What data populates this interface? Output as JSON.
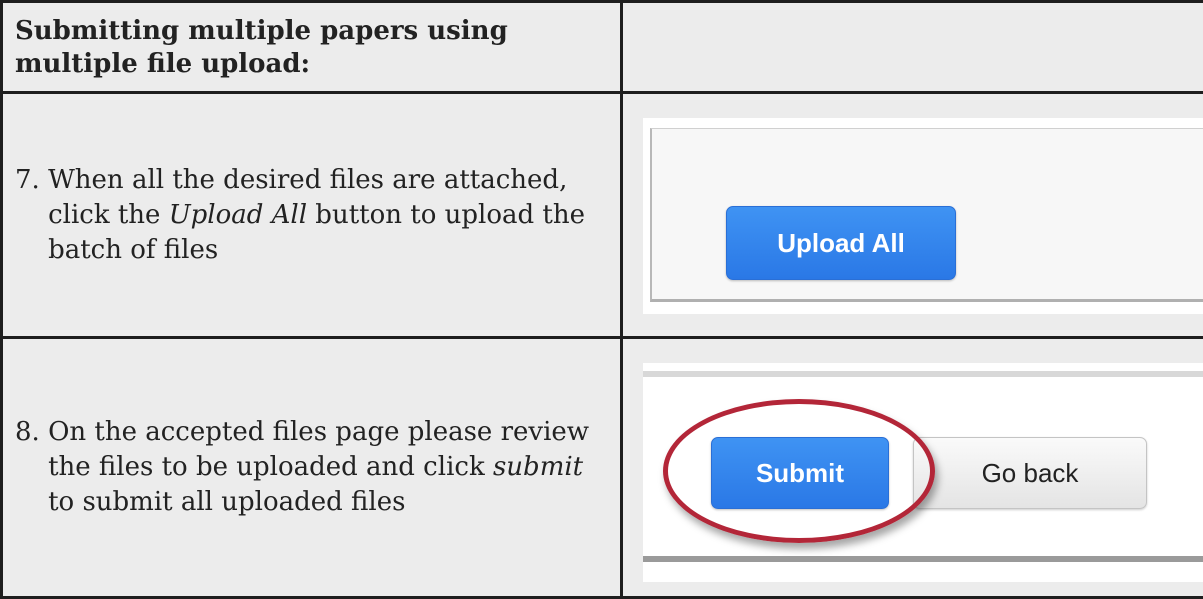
{
  "header": {
    "title": "Submitting multiple papers using multiple file upload:"
  },
  "steps": [
    {
      "number": "7. ",
      "text_before": "When all the desired files are attached, click the ",
      "emphasis": "Upload All",
      "text_after": " button to upload the batch of files",
      "screenshot": {
        "button_label": "Upload All"
      }
    },
    {
      "number": "8. ",
      "text_before": "On the accepted files page please review the files to be uploaded and click ",
      "emphasis": "submit",
      "text_after": " to submit all uploaded files",
      "screenshot": {
        "primary_button_label": "Submit",
        "secondary_button_label": "Go back"
      }
    }
  ],
  "colors": {
    "cell_background": "#ececec",
    "button_blue": "#2a78e6",
    "highlight_ring": "#b32638",
    "border": "#1e1e1e"
  }
}
